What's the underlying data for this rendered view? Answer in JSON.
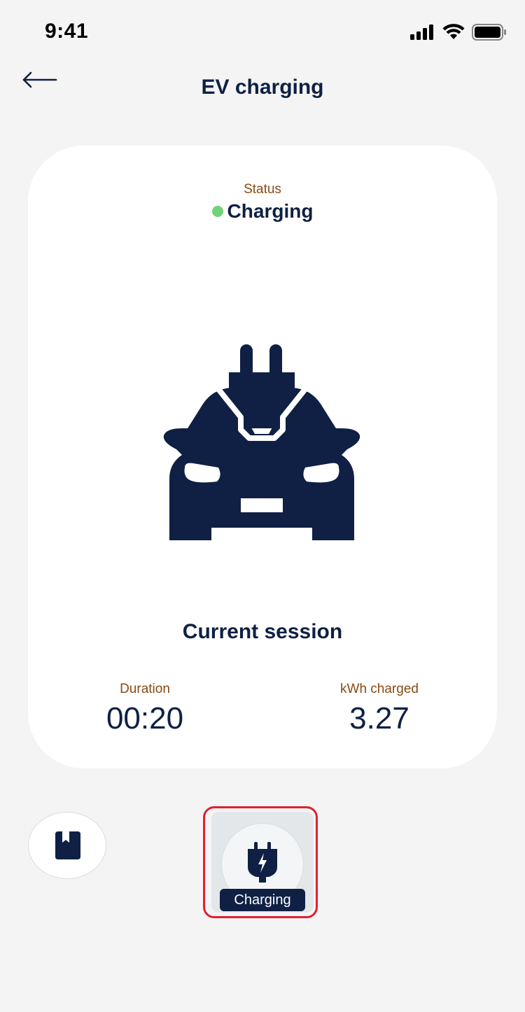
{
  "status_bar": {
    "time": "9:41"
  },
  "header": {
    "title": "EV charging"
  },
  "card": {
    "status_label": "Status",
    "status_value": "Charging",
    "status_color": "#6fd37a",
    "session_title": "Current session",
    "metrics": [
      {
        "label": "Duration",
        "value": "00:20"
      },
      {
        "label": "kWh charged",
        "value": "3.27"
      }
    ]
  },
  "bottom_nav": {
    "bookmark_icon": "bookmark-icon",
    "charging_label": "Charging"
  },
  "colors": {
    "navy": "#0f2044",
    "label_brown": "#8a4a12",
    "highlight_red": "#e02030"
  }
}
